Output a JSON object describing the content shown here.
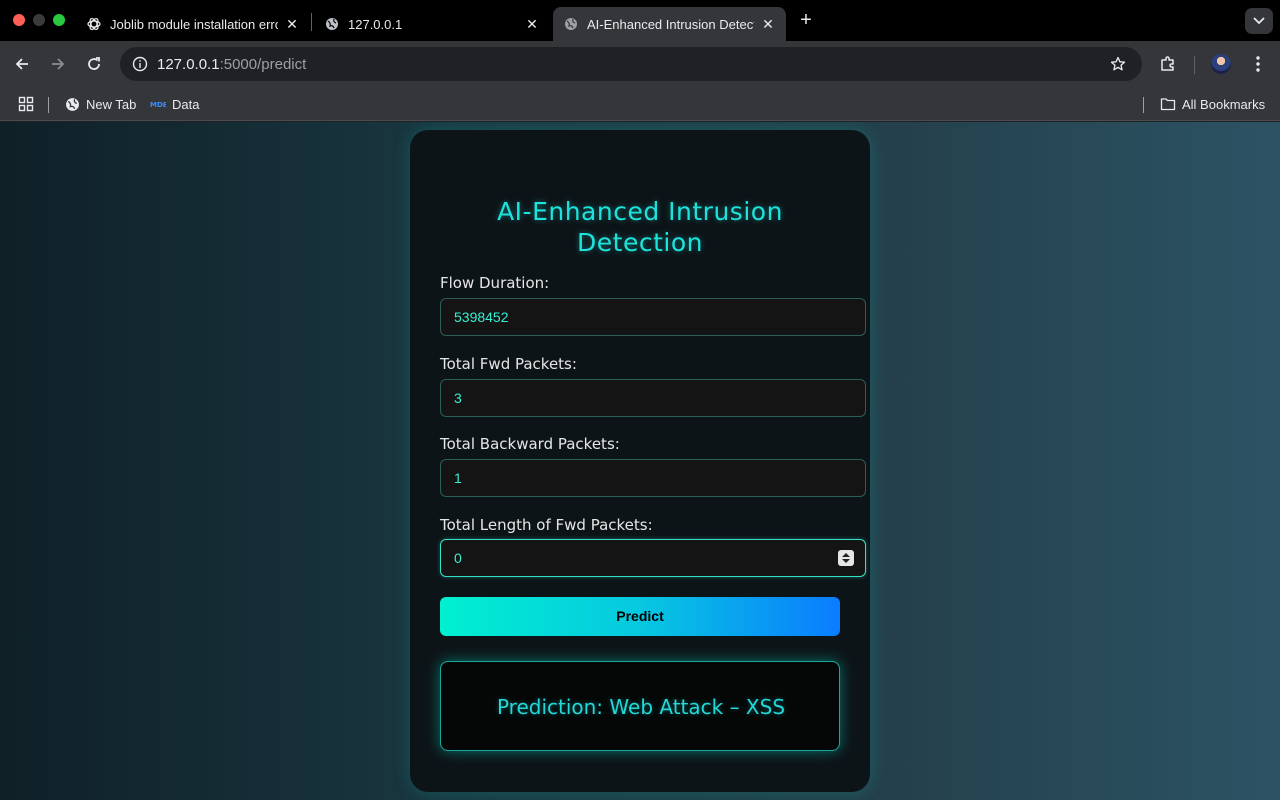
{
  "browser": {
    "tabs": [
      {
        "title": "Joblib module installation erro",
        "active": false
      },
      {
        "title": "127.0.0.1",
        "active": false
      },
      {
        "title": "AI-Enhanced Intrusion Detect",
        "active": true
      }
    ],
    "address": {
      "host": "127.0.0.1",
      "path": ":5000/predict"
    },
    "bookmarks": [
      {
        "label": "New Tab"
      },
      {
        "label": "Data"
      }
    ],
    "all_bookmarks_label": "All Bookmarks"
  },
  "app": {
    "title_line1": "AI-Enhanced Intrusion",
    "title_line2": "Detection",
    "fields": [
      {
        "label": "Flow Duration:",
        "value": "5398452"
      },
      {
        "label": "Total Fwd Packets:",
        "value": "3"
      },
      {
        "label": "Total Backward Packets:",
        "value": "1"
      },
      {
        "label": "Total Length of Fwd Packets:",
        "value": "0"
      }
    ],
    "predict_label": "Predict",
    "result_text": "Prediction: Web Attack – XSS"
  },
  "colors": {
    "accent": "#1ee3dc",
    "button_start": "#00f0d0",
    "button_end": "#0a7cff"
  }
}
